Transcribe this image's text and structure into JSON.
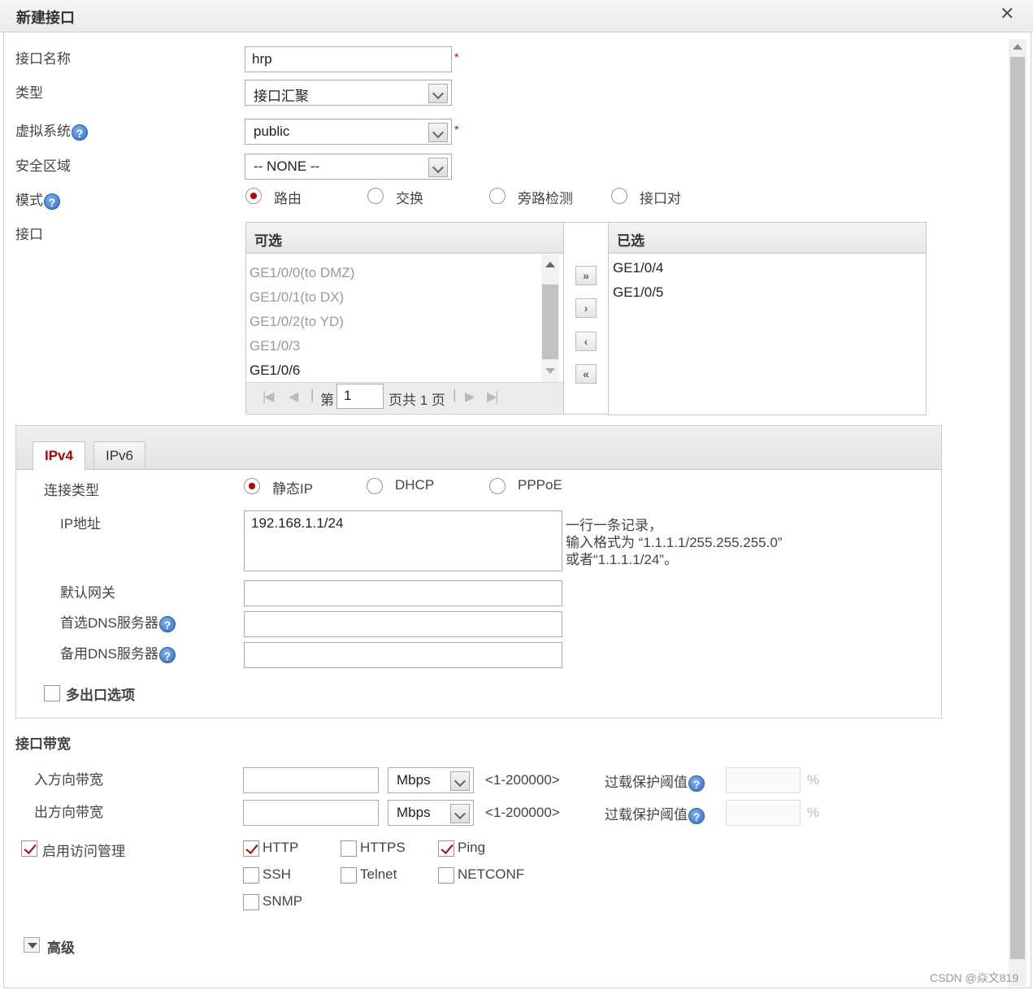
{
  "dialog": {
    "title": "新建接口",
    "close": "✕"
  },
  "form": {
    "name_label": "接口名称",
    "name_value": "hrp",
    "required_mark": "*",
    "type_label": "类型",
    "type_value": "接口汇聚",
    "vsys_label": "虚拟系统",
    "vsys_value": "public",
    "zone_label": "安全区域",
    "zone_value": "-- NONE --",
    "mode_label": "模式",
    "modes": [
      "路由",
      "交换",
      "旁路检测",
      "接口对"
    ],
    "iface_label": "接口",
    "help_glyph": "?"
  },
  "available": {
    "header": "可选",
    "items": [
      "GE1/0/0(to DMZ)",
      "GE1/0/1(to DX)",
      "GE1/0/2(to YD)",
      "GE1/0/3",
      "GE1/0/6"
    ],
    "pager_prefix": "第",
    "page": "1",
    "pager_suffix": "页共 1 页"
  },
  "selected": {
    "header": "已选",
    "items": [
      "GE1/0/4",
      "GE1/0/5"
    ]
  },
  "move_buttons": [
    "»",
    "›",
    "‹",
    "«"
  ],
  "ip": {
    "tabs": [
      "IPv4",
      "IPv6"
    ],
    "conn_label": "连接类型",
    "conn_types": [
      "静态IP",
      "DHCP",
      "PPPoE"
    ],
    "ip_label": "IP地址",
    "ip_value": "192.168.1.1/24",
    "hint": [
      "一行一条记录，",
      "输入格式为 “1.1.1.1/255.255.255.0”",
      "或者“1.1.1.1/24”。"
    ],
    "gw_label": "默认网关",
    "dns1_label": "首选DNS服务器",
    "dns2_label": "备用DNS服务器",
    "multi_exit_label": "多出口选项"
  },
  "bandwidth": {
    "section_label": "接口带宽",
    "in_label": "入方向带宽",
    "out_label": "出方向带宽",
    "unit": "Mbps",
    "range": "<1-200000>",
    "overload_label": "过载保护阈值",
    "percent": "%"
  },
  "access": {
    "enable_label": "启用访问管理",
    "protocols": [
      {
        "name": "HTTP",
        "checked": true
      },
      {
        "name": "HTTPS",
        "checked": false
      },
      {
        "name": "Ping",
        "checked": true
      },
      {
        "name": "SSH",
        "checked": false
      },
      {
        "name": "Telnet",
        "checked": false
      },
      {
        "name": "NETCONF",
        "checked": false
      },
      {
        "name": "SNMP",
        "checked": false
      }
    ]
  },
  "advanced_label": "高级",
  "watermark": "CSDN @焱文819"
}
